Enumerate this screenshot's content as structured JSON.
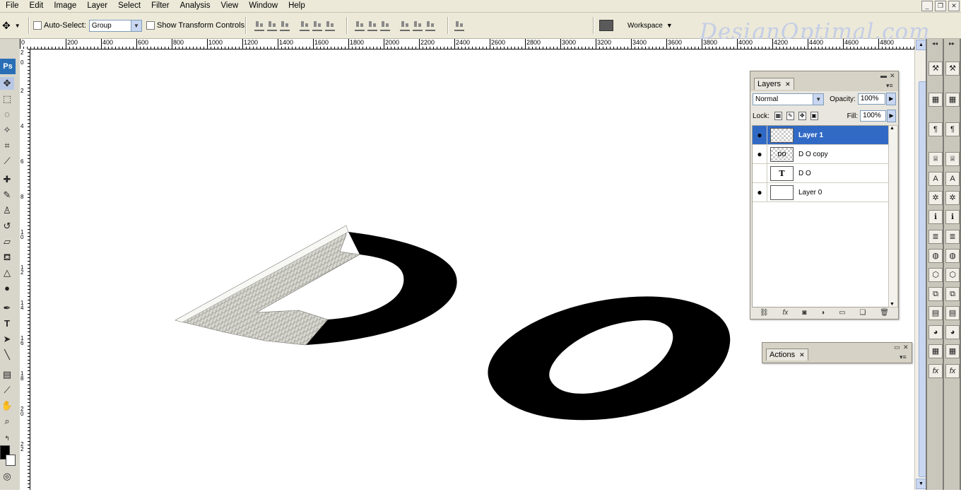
{
  "menu": [
    "File",
    "Edit",
    "Image",
    "Layer",
    "Select",
    "Filter",
    "Analysis",
    "View",
    "Window",
    "Help"
  ],
  "window_controls": {
    "minimize": "_",
    "restore": "❐",
    "close": "✕"
  },
  "options": {
    "auto_select_label": "Auto-Select:",
    "auto_select_value": "Group",
    "show_transform_label": "Show Transform Controls",
    "workspace_label": "Workspace"
  },
  "watermark": "DesignOptimal.com",
  "toolbox": {
    "logo": "Ps"
  },
  "ruler": {
    "top": [
      "0",
      "200",
      "400",
      "600",
      "800",
      "1000",
      "1200",
      "1400",
      "1600",
      "1800",
      "2000",
      "2200",
      "2400",
      "2600",
      "2800",
      "3000",
      "3200",
      "3400",
      "3600",
      "3800",
      "4000",
      "4200",
      "4400",
      "4600",
      "4800"
    ],
    "left": [
      "2",
      "0",
      "2",
      "4",
      "6",
      "8",
      "1 0",
      "1 2",
      "1 4",
      "1 6",
      "1 8",
      "2 0",
      "2 2"
    ]
  },
  "layers_panel": {
    "tab": "Layers",
    "blend_mode": "Normal",
    "opacity_label": "Opacity:",
    "opacity_value": "100%",
    "lock_label": "Lock:",
    "fill_label": "Fill:",
    "fill_value": "100%",
    "layers": [
      {
        "name": "Layer 1",
        "visible": true,
        "selected": true,
        "thumb": ""
      },
      {
        "name": "D O copy",
        "visible": true,
        "selected": false,
        "thumb": "ᴅo"
      },
      {
        "name": "D O",
        "visible": false,
        "selected": false,
        "thumb": "T"
      },
      {
        "name": "Layer 0",
        "visible": true,
        "selected": false,
        "thumb": ""
      }
    ]
  },
  "actions_panel": {
    "tab": "Actions"
  },
  "colors": {
    "selection": "#316ac5",
    "chrome": "#ece9d8",
    "watermark": "#c4cde6"
  }
}
